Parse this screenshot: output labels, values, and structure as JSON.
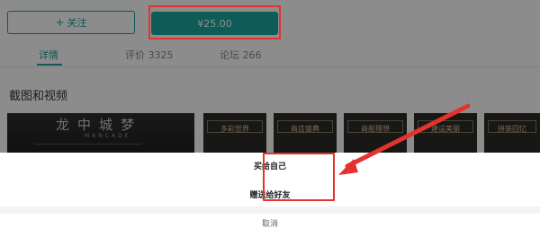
{
  "header": {
    "follow_label": "关注",
    "price_label": "¥25.00"
  },
  "tabs": [
    {
      "label": "详情"
    },
    {
      "label": "评价 3325"
    },
    {
      "label": "论坛 266"
    }
  ],
  "section": {
    "title": "截图和视频"
  },
  "thumbnails": {
    "big_title": "龙中城梦",
    "big_subtitle": "MANCADE",
    "items": [
      {
        "caption": "多彩世界"
      },
      {
        "caption": "商店盛典"
      },
      {
        "caption": "商船理想"
      },
      {
        "caption": "建设美丽"
      },
      {
        "caption": "拼装回忆"
      }
    ]
  },
  "sheet": {
    "buy_self": "买给自己",
    "gift_friend": "赠送给好友",
    "cancel": "取消"
  },
  "colors": {
    "accent": "#1aa39a",
    "highlight_red": "#e2332e"
  }
}
